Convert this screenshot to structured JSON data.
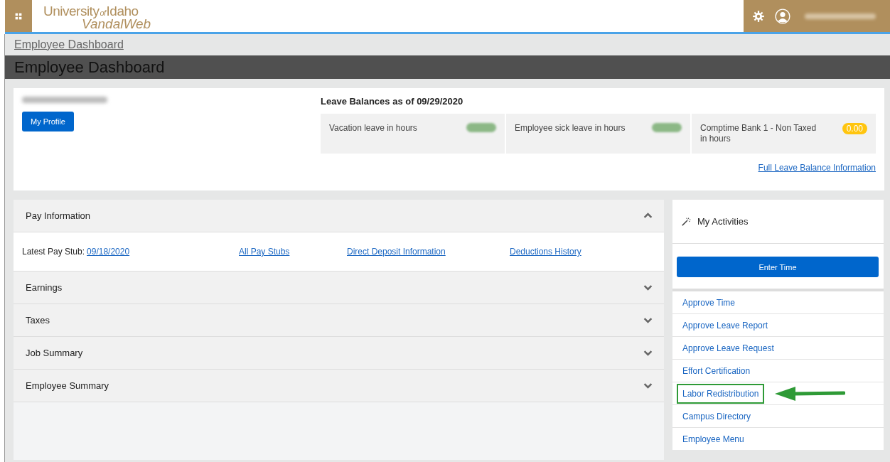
{
  "header": {
    "logo_top": "University",
    "logo_of": "of",
    "logo_idaho": "Idaho",
    "logo_bottom": "VandalWeb"
  },
  "breadcrumb": "Employee Dashboard",
  "page_title": "Employee Dashboard",
  "profile": {
    "button": "My Profile"
  },
  "leave": {
    "title": "Leave Balances as of 09/29/2020",
    "items": [
      {
        "label": "Vacation leave in hours",
        "kind": "hidden"
      },
      {
        "label": "Employee sick leave in hours",
        "kind": "hidden"
      },
      {
        "label": "Comptime Bank 1 - Non Taxed in hours",
        "kind": "value",
        "value": "0.00"
      }
    ],
    "link": "Full Leave Balance Information"
  },
  "pay": {
    "title": "Pay Information",
    "expanded": true,
    "stub_label": "Latest Pay Stub:",
    "stub_date": "09/18/2020",
    "links": [
      "All Pay Stubs",
      "Direct Deposit Information",
      "Deductions History"
    ]
  },
  "sections": [
    {
      "title": "Earnings",
      "expanded": false
    },
    {
      "title": "Taxes",
      "expanded": false
    },
    {
      "title": "Job Summary",
      "expanded": false
    },
    {
      "title": "Employee Summary",
      "expanded": false
    }
  ],
  "activities": {
    "title": "My Activities",
    "button": "Enter Time",
    "items": [
      {
        "label": "Approve Time",
        "highlighted": false
      },
      {
        "label": "Approve Leave Report",
        "highlighted": false
      },
      {
        "label": "Approve Leave Request",
        "highlighted": false
      },
      {
        "label": "Effort Certification",
        "highlighted": false
      },
      {
        "label": "Labor Redistribution",
        "highlighted": true
      },
      {
        "label": "Campus Directory",
        "highlighted": false
      },
      {
        "label": "Employee Menu",
        "highlighted": false
      }
    ]
  }
}
